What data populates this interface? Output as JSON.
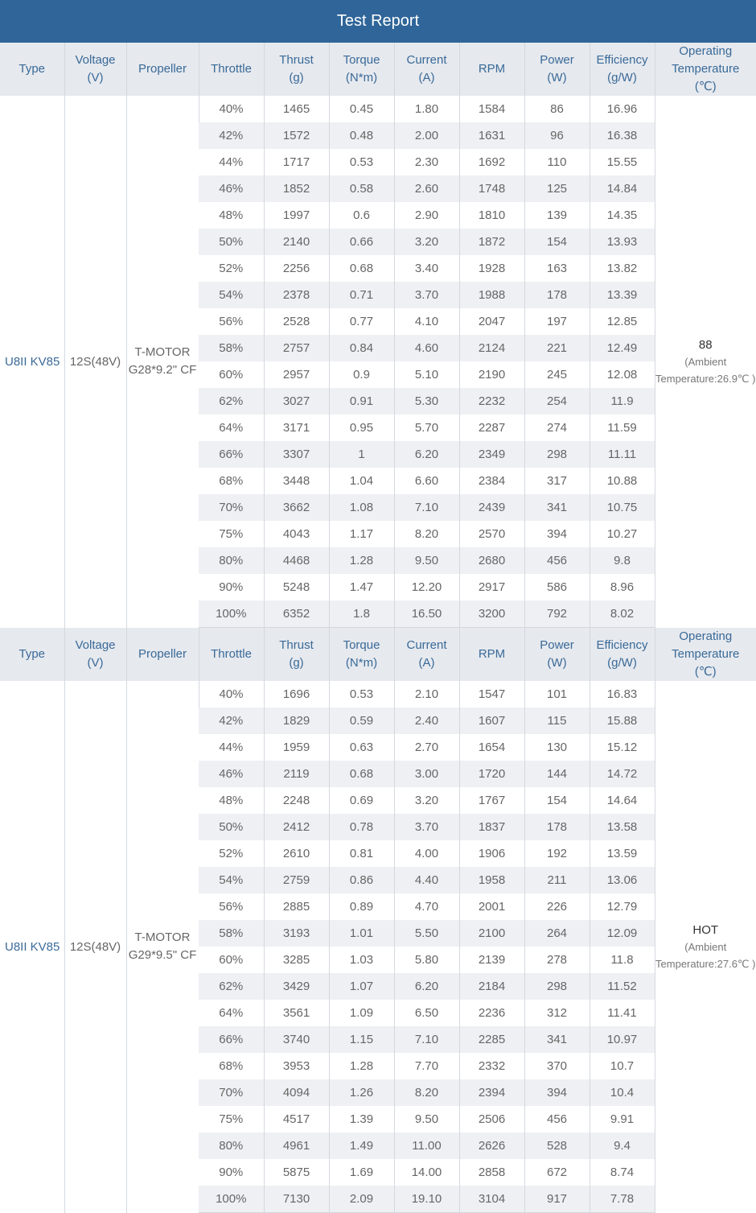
{
  "title": "Test Report",
  "headers": {
    "type": "Type",
    "voltage": "Voltage\n(V)",
    "propeller": "Propeller",
    "throttle": "Throttle",
    "thrust": "Thrust\n(g)",
    "torque": "Torque\n(N*m)",
    "current": "Current\n(A)",
    "rpm": "RPM",
    "power": "Power\n(W)",
    "efficiency": "Efficiency\n(g/W)",
    "temperature": "Operating\nTemperature\n(℃)"
  },
  "groups": [
    {
      "type": "U8II KV85",
      "voltage": "12S(48V)",
      "propeller": "T-MOTOR G28*9.2\" CF",
      "temp_main": "88",
      "temp_sub": "(Ambient Temperature:26.9℃ )",
      "rows": [
        [
          "40%",
          "1465",
          "0.45",
          "1.80",
          "1584",
          "86",
          "16.96"
        ],
        [
          "42%",
          "1572",
          "0.48",
          "2.00",
          "1631",
          "96",
          "16.38"
        ],
        [
          "44%",
          "1717",
          "0.53",
          "2.30",
          "1692",
          "110",
          "15.55"
        ],
        [
          "46%",
          "1852",
          "0.58",
          "2.60",
          "1748",
          "125",
          "14.84"
        ],
        [
          "48%",
          "1997",
          "0.6",
          "2.90",
          "1810",
          "139",
          "14.35"
        ],
        [
          "50%",
          "2140",
          "0.66",
          "3.20",
          "1872",
          "154",
          "13.93"
        ],
        [
          "52%",
          "2256",
          "0.68",
          "3.40",
          "1928",
          "163",
          "13.82"
        ],
        [
          "54%",
          "2378",
          "0.71",
          "3.70",
          "1988",
          "178",
          "13.39"
        ],
        [
          "56%",
          "2528",
          "0.77",
          "4.10",
          "2047",
          "197",
          "12.85"
        ],
        [
          "58%",
          "2757",
          "0.84",
          "4.60",
          "2124",
          "221",
          "12.49"
        ],
        [
          "60%",
          "2957",
          "0.9",
          "5.10",
          "2190",
          "245",
          "12.08"
        ],
        [
          "62%",
          "3027",
          "0.91",
          "5.30",
          "2232",
          "254",
          "11.9"
        ],
        [
          "64%",
          "3171",
          "0.95",
          "5.70",
          "2287",
          "274",
          "11.59"
        ],
        [
          "66%",
          "3307",
          "1",
          "6.20",
          "2349",
          "298",
          "11.11"
        ],
        [
          "68%",
          "3448",
          "1.04",
          "6.60",
          "2384",
          "317",
          "10.88"
        ],
        [
          "70%",
          "3662",
          "1.08",
          "7.10",
          "2439",
          "341",
          "10.75"
        ],
        [
          "75%",
          "4043",
          "1.17",
          "8.20",
          "2570",
          "394",
          "10.27"
        ],
        [
          "80%",
          "4468",
          "1.28",
          "9.50",
          "2680",
          "456",
          "9.8"
        ],
        [
          "90%",
          "5248",
          "1.47",
          "12.20",
          "2917",
          "586",
          "8.96"
        ],
        [
          "100%",
          "6352",
          "1.8",
          "16.50",
          "3200",
          "792",
          "8.02"
        ]
      ]
    },
    {
      "type": "U8II KV85",
      "voltage": "12S(48V)",
      "propeller": "T-MOTOR G29*9.5\" CF",
      "temp_main": "HOT",
      "temp_sub": "(Ambient Temperature:27.6℃ )",
      "rows": [
        [
          "40%",
          "1696",
          "0.53",
          "2.10",
          "1547",
          "101",
          "16.83"
        ],
        [
          "42%",
          "1829",
          "0.59",
          "2.40",
          "1607",
          "115",
          "15.88"
        ],
        [
          "44%",
          "1959",
          "0.63",
          "2.70",
          "1654",
          "130",
          "15.12"
        ],
        [
          "46%",
          "2119",
          "0.68",
          "3.00",
          "1720",
          "144",
          "14.72"
        ],
        [
          "48%",
          "2248",
          "0.69",
          "3.20",
          "1767",
          "154",
          "14.64"
        ],
        [
          "50%",
          "2412",
          "0.78",
          "3.70",
          "1837",
          "178",
          "13.58"
        ],
        [
          "52%",
          "2610",
          "0.81",
          "4.00",
          "1906",
          "192",
          "13.59"
        ],
        [
          "54%",
          "2759",
          "0.86",
          "4.40",
          "1958",
          "211",
          "13.06"
        ],
        [
          "56%",
          "2885",
          "0.89",
          "4.70",
          "2001",
          "226",
          "12.79"
        ],
        [
          "58%",
          "3193",
          "1.01",
          "5.50",
          "2100",
          "264",
          "12.09"
        ],
        [
          "60%",
          "3285",
          "1.03",
          "5.80",
          "2139",
          "278",
          "11.8"
        ],
        [
          "62%",
          "3429",
          "1.07",
          "6.20",
          "2184",
          "298",
          "11.52"
        ],
        [
          "64%",
          "3561",
          "1.09",
          "6.50",
          "2236",
          "312",
          "11.41"
        ],
        [
          "66%",
          "3740",
          "1.15",
          "7.10",
          "2285",
          "341",
          "10.97"
        ],
        [
          "68%",
          "3953",
          "1.28",
          "7.70",
          "2332",
          "370",
          "10.7"
        ],
        [
          "70%",
          "4094",
          "1.26",
          "8.20",
          "2394",
          "394",
          "10.4"
        ],
        [
          "75%",
          "4517",
          "1.39",
          "9.50",
          "2506",
          "456",
          "9.91"
        ],
        [
          "80%",
          "4961",
          "1.49",
          "11.00",
          "2626",
          "528",
          "9.4"
        ],
        [
          "90%",
          "5875",
          "1.69",
          "14.00",
          "2858",
          "672",
          "8.74"
        ],
        [
          "100%",
          "7130",
          "2.09",
          "19.10",
          "3104",
          "917",
          "7.78"
        ]
      ]
    }
  ]
}
